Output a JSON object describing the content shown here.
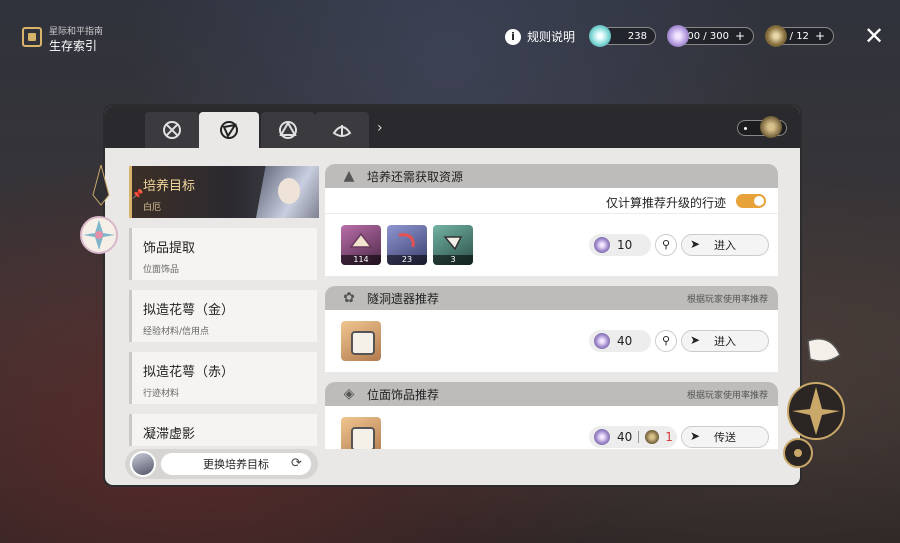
{
  "header": {
    "guide_subtitle": "星际和平指南",
    "guide_title": "生存索引",
    "rules_label": "规则说明",
    "resources": [
      {
        "icon": "stellar-jade-icon",
        "value": "238"
      },
      {
        "icon": "trailblaze-power-icon",
        "value": "300 / 300",
        "plus": "+"
      },
      {
        "icon": "fuel-icon",
        "value": "0 / 12",
        "plus": "+"
      }
    ],
    "close_glyph": "✕"
  },
  "tabs": [
    {
      "name": "tab-combat",
      "icon": "combat-icon",
      "active": false
    },
    {
      "name": "tab-survival",
      "icon": "survival-icon",
      "active": true
    },
    {
      "name": "tab-treasure",
      "icon": "treasure-icon",
      "active": false
    },
    {
      "name": "tab-lotus",
      "icon": "lotus-icon",
      "active": false
    }
  ],
  "left_list": {
    "items": [
      {
        "title": "培养目标",
        "sub": "白厄",
        "active": true
      },
      {
        "title": "饰品提取",
        "sub": "位面饰品"
      },
      {
        "title": "拟造花萼（金）",
        "sub": "经验材料/信用点"
      },
      {
        "title": "拟造花萼（赤）",
        "sub": "行迹材料"
      },
      {
        "title": "凝滞虚影",
        "sub": ""
      }
    ],
    "change_target_label": "更换培养目标"
  },
  "sections": {
    "training": {
      "title": "培养还需获取资源",
      "toggle_label": "仅计算推荐升级的行迹",
      "toggle_on": true,
      "materials": [
        {
          "count": "114",
          "color": "#8a4b7a"
        },
        {
          "count": "23",
          "color": "#6a72a8"
        },
        {
          "count": "3",
          "color": "#4a8a7a"
        }
      ],
      "cost": "10",
      "enter_label": "进入"
    },
    "cavern": {
      "title": "隧洞遗器推荐",
      "note": "根据玩家使用率推荐",
      "cost": "40",
      "enter_label": "进入"
    },
    "planar": {
      "title": "位面饰品推荐",
      "note": "根据玩家使用率推荐",
      "cost": "40",
      "fuel": "1",
      "teleport_label": "传送"
    }
  },
  "colors": {
    "accent_gold": "#d8b46a",
    "toggle_orange": "#e8a23a",
    "alert_red": "#d23c3c"
  }
}
